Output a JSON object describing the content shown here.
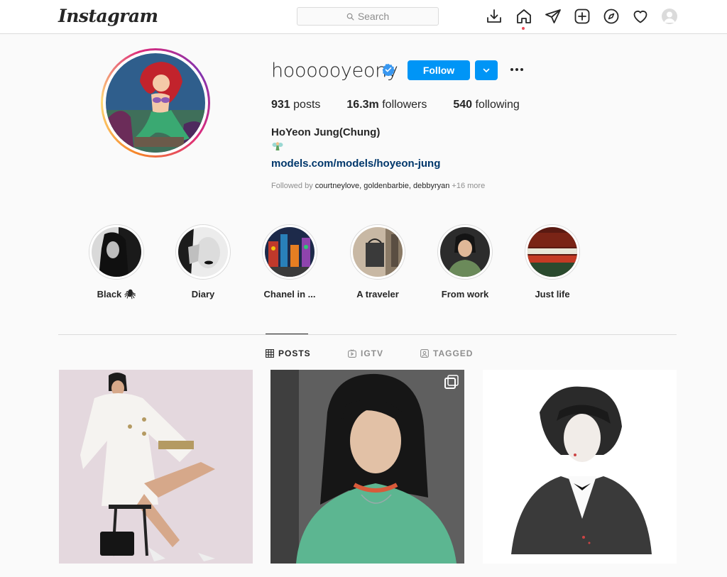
{
  "nav": {
    "logo": "Instagram",
    "search_placeholder": "Search",
    "icons": [
      "download-icon",
      "home-icon",
      "direct-icon",
      "new-post-icon",
      "explore-icon",
      "activity-icon",
      "profile-avatar"
    ]
  },
  "profile": {
    "username": "hoooooyeony",
    "verified": true,
    "follow_label": "Follow",
    "stats": [
      {
        "count": "931",
        "label": "posts"
      },
      {
        "count": "16.3m",
        "label": "followers"
      },
      {
        "count": "540",
        "label": "following"
      }
    ],
    "full_name": "HoYeon Jung(Chung)",
    "bio_emoji": "fairy-emoji",
    "link": "models.com/models/hoyeon-jung",
    "followed_by_prefix": "Followed by",
    "followed_by_names": "courtneylove, goldenbarbie, debbyryan",
    "followed_by_more": "+16 more"
  },
  "highlights": [
    {
      "label": "Black 🕷"
    },
    {
      "label": "Diary"
    },
    {
      "label": "Chanel in ..."
    },
    {
      "label": "A traveler"
    },
    {
      "label": "From work"
    },
    {
      "label": "Just life"
    }
  ],
  "tabs": [
    {
      "label": "POSTS",
      "active": true,
      "icon": "grid-icon"
    },
    {
      "label": "IGTV",
      "active": false,
      "icon": "igtv-icon"
    },
    {
      "label": "TAGGED",
      "active": false,
      "icon": "tagged-icon"
    }
  ],
  "colors": {
    "accent": "#0095f6",
    "link": "#00376b",
    "muted": "#8e8e8e",
    "border": "#dbdbdb",
    "notification": "#ed4956"
  }
}
